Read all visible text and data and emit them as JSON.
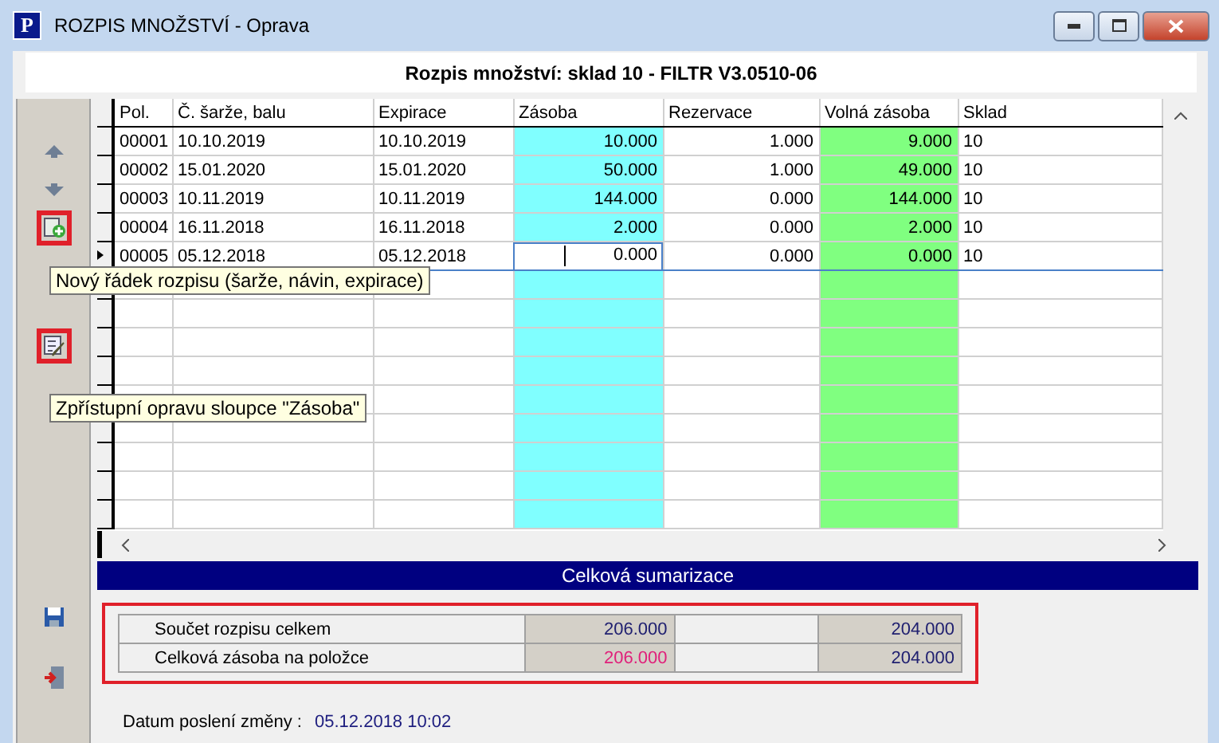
{
  "window": {
    "title": "ROZPIS MNOŽSTVÍ - Oprava",
    "logo": "P"
  },
  "header": "Rozpis množství: sklad 10 - FILTR V3.0510-06",
  "toolbar": [
    {
      "kind": "up",
      "highlighted": false
    },
    {
      "kind": "down",
      "highlighted": false
    },
    {
      "kind": "add",
      "highlighted": true,
      "tooltip": "Nový řádek rozpisu  (šarže, návin, expirace)"
    },
    {
      "kind": "edit",
      "highlighted": true,
      "tooltip": "Zpřístupní opravu sloupce \"Zásoba\""
    }
  ],
  "bottom_toolbar": [
    {
      "kind": "save"
    },
    {
      "kind": "exit"
    }
  ],
  "grid": {
    "columns": [
      "Pol.",
      "Č. šarže, balu",
      "Expirace",
      "Zásoba",
      "Rezervace",
      "Volná zásoba",
      "Sklad"
    ],
    "rows": [
      {
        "cells": [
          "00001",
          "10.10.2019",
          "10.10.2019",
          "10.000",
          "1.000",
          "9.000",
          "10"
        ],
        "selected": false
      },
      {
        "cells": [
          "00002",
          "15.01.2020",
          "15.01.2020",
          "50.000",
          "1.000",
          "49.000",
          "10"
        ],
        "selected": false
      },
      {
        "cells": [
          "00003",
          "10.11.2019",
          "10.11.2019",
          "144.000",
          "0.000",
          "144.000",
          "10"
        ],
        "selected": false
      },
      {
        "cells": [
          "00004",
          "16.11.2018",
          "16.11.2018",
          "2.000",
          "0.000",
          "2.000",
          "10"
        ],
        "selected": false
      },
      {
        "cells": [
          "00005",
          "05.12.2018",
          "05.12.2018",
          "0.000",
          "0.000",
          "0.000",
          "10"
        ],
        "selected": true
      }
    ]
  },
  "summary": {
    "title": "Celková sumarizace",
    "highlighted": true,
    "rows": [
      {
        "label": "Součet rozpisu celkem",
        "stock": "206.000",
        "free": "204.000",
        "alert": false
      },
      {
        "label": "Celková zásoba na položce",
        "stock": "206.000",
        "free": "204.000",
        "alert": true
      }
    ]
  },
  "last_change": {
    "label": "Datum poslení změny :",
    "value": "05.12.2018 10:02"
  }
}
